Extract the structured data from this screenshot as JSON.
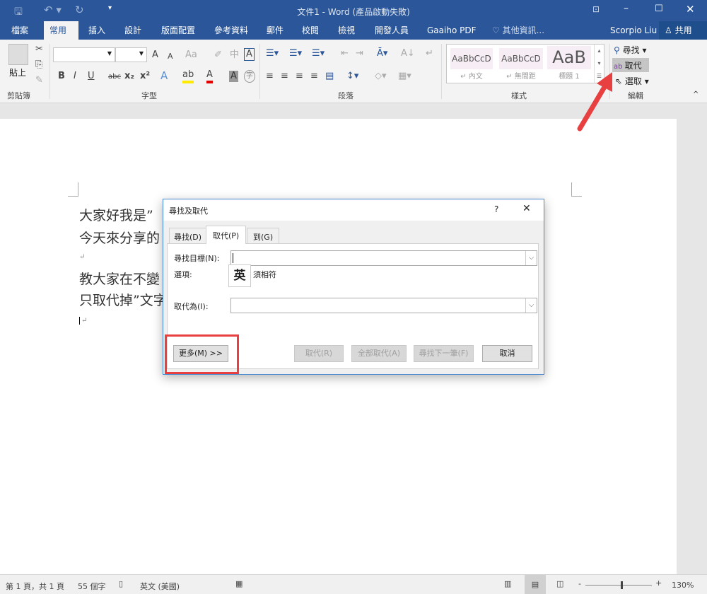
{
  "window": {
    "title": "文件1 - Word (產品啟動失敗)"
  },
  "quick_access": {
    "save": "save-icon",
    "undo": "undo-icon",
    "redo": "redo-icon",
    "customize": "customize-icon"
  },
  "tabs": [
    "檔案",
    "常用",
    "插入",
    "設計",
    "版面配置",
    "參考資料",
    "郵件",
    "校閱",
    "檢視",
    "開發人員",
    "Gaaiho PDF"
  ],
  "tell_me": "其他資訊...",
  "user": "Scorpio Liu",
  "share": "共用",
  "ribbon": {
    "clipboard": {
      "label": "剪貼簿",
      "paste": "貼上"
    },
    "font": {
      "label": "字型",
      "grow": "A",
      "shrink": "A",
      "case": "Aa",
      "bold": "B",
      "italic": "I",
      "underline": "U",
      "strike": "abc",
      "sub": "x₂",
      "sup": "x²",
      "color": "A",
      "shade": "A",
      "enclose": "字",
      "phonetic": "中"
    },
    "paragraph": {
      "label": "段落"
    },
    "styles": {
      "label": "樣式",
      "items": [
        {
          "preview": "AaBbCcD",
          "name": "↵ 內文"
        },
        {
          "preview": "AaBbCcD",
          "name": "↵ 無間距"
        },
        {
          "preview": "AaB",
          "name": "標題 1"
        }
      ]
    },
    "editing": {
      "label": "編輯",
      "find": "尋找",
      "replace": "取代",
      "select": "選取"
    }
  },
  "document": {
    "lines": [
      "大家好我是”",
      "今天來分享的",
      "↵",
      "教大家在不變",
      "只取代掉”文字",
      "↵"
    ]
  },
  "dialog": {
    "title": "尋找及取代",
    "help": "?",
    "close": "✕",
    "tabs": [
      "尋找(D)",
      "取代(P)",
      "到(G)"
    ],
    "find_label": "尋找目標(N):",
    "find_value": "",
    "options_label": "選項:",
    "options_value": "須相符",
    "ime_char": "英",
    "replace_label": "取代為(I):",
    "replace_value": "",
    "buttons": {
      "more": "更多(M) >>",
      "replace": "取代(R)",
      "replace_all": "全部取代(A)",
      "find_next": "尋找下一筆(F)",
      "cancel": "取消"
    }
  },
  "status": {
    "page": "第 1 頁，共 1 頁",
    "words": "55 個字",
    "language": "英文 (美國)",
    "zoom": "130%",
    "zoom_percent": 130
  },
  "annotation": {
    "color": "#e84040"
  }
}
